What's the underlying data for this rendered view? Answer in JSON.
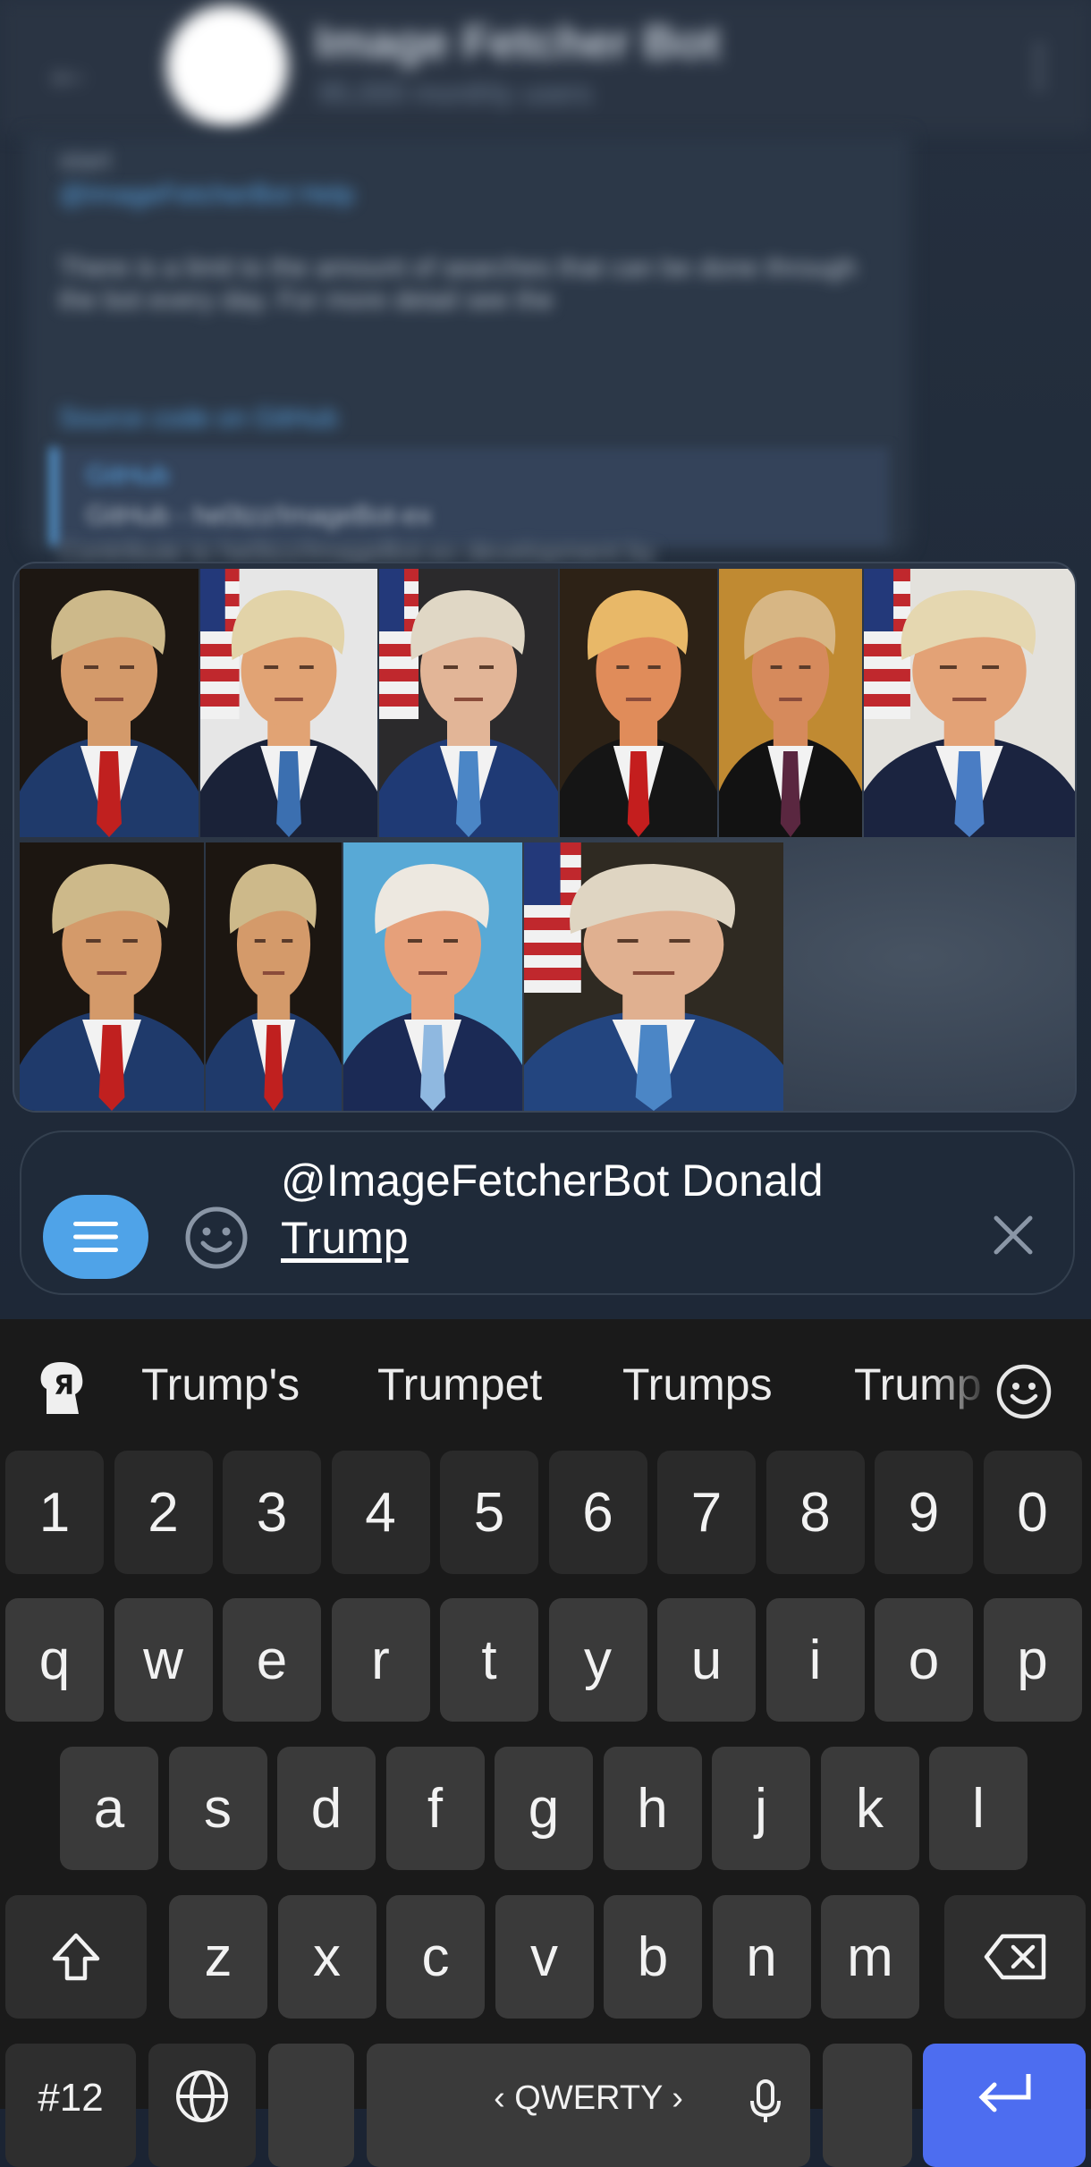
{
  "header": {
    "back_icon": "arrow-left-icon",
    "title": "Image Fetcher Bot",
    "subtitle": "95,000 monthly users",
    "menu_icon": "vertical-dots-icon"
  },
  "chat": {
    "lines": [
      "start",
      "@ImageFetcherBot Help",
      "There is a limit to the amount of searches that can be done through the bot every day. For more detail see the",
      "Source code on GitHub",
      "Contribute to he0tzz/ImageBot-ex development by"
    ],
    "quote_title": "GitHub",
    "quote_text": "GitHub - he0tzz/ImageBot-ex"
  },
  "results": {
    "images": [
      {
        "name": "result-image-1",
        "bg": "#1d1712",
        "suit": "#1f3a6b",
        "tie": "#c0201f",
        "hair": "#cdb98a",
        "skin": "#d49a6a",
        "flag": false
      },
      {
        "name": "result-image-2",
        "bg": "#e6e6e6",
        "suit": "#1a2238",
        "tie": "#3b6fb0",
        "hair": "#e2d3a8",
        "skin": "#e1a374",
        "flag": true
      },
      {
        "name": "result-image-3",
        "bg": "#2b2a2c",
        "suit": "#1f3a75",
        "tie": "#4b86c6",
        "hair": "#e0d7c5",
        "skin": "#e2b597",
        "flag": true
      },
      {
        "name": "result-image-4",
        "bg": "#2d2216",
        "suit": "#151515",
        "tie": "#c41e1e",
        "hair": "#e8b868",
        "skin": "#e08c5a",
        "flag": false
      },
      {
        "name": "result-image-5",
        "bg": "#c08a32",
        "suit": "#121212",
        "tie": "#5a2740",
        "hair": "#d7b684",
        "skin": "#d68a5c",
        "flag": false
      },
      {
        "name": "result-image-6",
        "bg": "#e3e1dc",
        "suit": "#1b2440",
        "tie": "#4a7dc4",
        "hair": "#e5d7b0",
        "skin": "#e3a276",
        "flag": true
      },
      {
        "name": "result-image-7",
        "bg": "#1c1611",
        "suit": "#1f3a6b",
        "tie": "#c0201f",
        "hair": "#cdb98a",
        "skin": "#d49a6a",
        "flag": false
      },
      {
        "name": "result-image-8",
        "bg": "#1c1611",
        "suit": "#1f3a6b",
        "tie": "#c0201f",
        "hair": "#cdb98a",
        "skin": "#d49a6a",
        "flag": false
      },
      {
        "name": "result-image-9",
        "bg": "#58a9d6",
        "suit": "#1b2a55",
        "tie": "#8fb8e0",
        "hair": "#ede8e0",
        "skin": "#e6a07a",
        "flag": false
      },
      {
        "name": "result-image-10",
        "bg": "#2f2a22",
        "suit": "#23457f",
        "tie": "#4b86c6",
        "hair": "#dfd5c2",
        "skin": "#e0b090",
        "flag": true
      }
    ]
  },
  "input": {
    "menu_icon": "menu-lines-icon",
    "emoji_icon": "smiley-icon",
    "text_prefix": "@ImageFetcherBot Donald",
    "text_query": "Trump",
    "clear_icon": "close-icon"
  },
  "keyboard": {
    "brand_icon": "yandex-keyboard-icon",
    "suggestions": [
      "Trump's",
      "Trumpet",
      "Trumps",
      "Trump"
    ],
    "emoji_icon": "smiley-icon",
    "number_row": [
      "1",
      "2",
      "3",
      "4",
      "5",
      "6",
      "7",
      "8",
      "9",
      "0"
    ],
    "row1": [
      "q",
      "w",
      "e",
      "r",
      "t",
      "y",
      "u",
      "i",
      "o",
      "p"
    ],
    "row2": [
      "a",
      "s",
      "d",
      "f",
      "g",
      "h",
      "j",
      "k",
      "l"
    ],
    "row3": [
      "z",
      "x",
      "c",
      "v",
      "b",
      "n",
      "m"
    ],
    "shift_icon": "shift-arrow-icon",
    "backspace_icon": "backspace-icon",
    "symbols_label": "#12",
    "globe_icon": "globe-icon",
    "space_label": "‹ QWERTY ›",
    "mic_icon": "microphone-icon",
    "enter_icon": "enter-arrow-icon"
  }
}
